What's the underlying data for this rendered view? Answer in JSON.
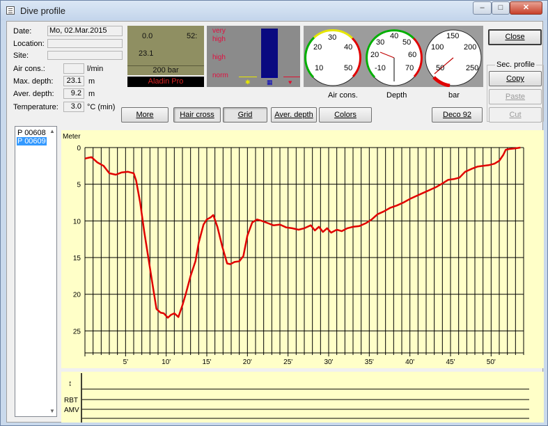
{
  "window": {
    "title": "Dive profile",
    "minimize": "–",
    "maximize": "□",
    "close": "✕"
  },
  "info": {
    "date_label": "Date:",
    "date_value": "Mo, 02.Mar.2015",
    "location_label": "Location:",
    "location_value": "",
    "site_label": "Site:",
    "site_value": "",
    "air_label": "Air cons.:",
    "air_value": "",
    "air_unit": "l/min",
    "maxdepth_label": "Max. depth:",
    "maxdepth_value": "23.1",
    "maxdepth_unit": "m",
    "averdepth_label": "Aver. depth:",
    "averdepth_value": "9.2",
    "averdepth_unit": "m",
    "temp_label": "Temperature:",
    "temp_value": "3.0",
    "temp_unit": "°C  (min)"
  },
  "computer": {
    "left": "0.0",
    "right": "52:",
    "depth": "23.1",
    "pressure": "200 bar",
    "brand": "Aladin Pro"
  },
  "levels": {
    "very_high_1": "very",
    "very_high_2": "high",
    "high": "high",
    "norm": "norm"
  },
  "gauges": {
    "air": {
      "caption": "Air cons.",
      "ticks": [
        "10",
        "20",
        "30",
        "40",
        "50"
      ]
    },
    "depth": {
      "caption": "Depth",
      "ticks": [
        "-10",
        "20",
        "30",
        "40",
        "50",
        "60",
        "70"
      ]
    },
    "bar": {
      "caption": "bar",
      "ticks": [
        "50",
        "100",
        "150",
        "200",
        "250"
      ]
    }
  },
  "toolbar": {
    "more": "More",
    "hair_cross": "Hair cross",
    "grid": "Grid",
    "aver_depth": "Aver. depth",
    "colors": "Colors",
    "deco": "Deco 92"
  },
  "side": {
    "close": "Close",
    "sec_profile": "Sec. profile",
    "copy": "Copy",
    "paste": "Paste",
    "cut": "Cut"
  },
  "profiles": [
    "P 00608",
    "P 00609"
  ],
  "chart_data": {
    "type": "line",
    "ylabel": "Meter",
    "xlabel": "",
    "y_reversed": true,
    "ylim": [
      0,
      28
    ],
    "xlim": [
      0,
      54
    ],
    "y_ticks": [
      0,
      5,
      10,
      15,
      20,
      25
    ],
    "x_tick_labels": [
      "5'",
      "10'",
      "15'",
      "20'",
      "25'",
      "30'",
      "35'",
      "40'",
      "45'",
      "50'"
    ],
    "x_ticks": [
      5,
      10,
      15,
      20,
      25,
      30,
      35,
      40,
      45,
      50
    ],
    "grid": true,
    "series": [
      {
        "color": "#e00000",
        "x": [
          0,
          0.8,
          1.5,
          2.3,
          3.0,
          3.8,
          4.5,
          5.3,
          6.0,
          6.3,
          6.8,
          7.3,
          7.8,
          8.3,
          8.8,
          9.3,
          9.7,
          10.2,
          10.6,
          11.0,
          11.5,
          12.0,
          12.4,
          13.0,
          13.6,
          14.0,
          14.6,
          15.0,
          15.5,
          15.8,
          16.3,
          16.9,
          17.5,
          17.9,
          18.4,
          19.0,
          19.5,
          20.0,
          20.6,
          21.2,
          21.8,
          22.5,
          23.2,
          24.0,
          24.8,
          25.5,
          26.3,
          27.0,
          27.8,
          28.3,
          28.8,
          29.3,
          29.8,
          30.3,
          31.0,
          31.6,
          32.3,
          33.0,
          33.8,
          34.6,
          35.3,
          36.0,
          36.8,
          37.6,
          38.4,
          39.2,
          40.0,
          40.8,
          41.6,
          42.4,
          43.2,
          44.0,
          44.7,
          45.4,
          46.1,
          46.8,
          47.6,
          48.3,
          49.0,
          49.7,
          50.4,
          51.0,
          51.5,
          51.8,
          52.2,
          53.0,
          53.6
        ],
        "y": [
          1.5,
          1.3,
          2.0,
          2.5,
          3.5,
          3.7,
          3.4,
          3.3,
          3.5,
          4.5,
          7.5,
          11.5,
          15.0,
          18.5,
          22.0,
          22.5,
          22.6,
          23.2,
          22.8,
          22.6,
          23.1,
          21.5,
          20.0,
          17.5,
          15.5,
          13.0,
          10.5,
          9.8,
          9.5,
          9.2,
          10.8,
          13.5,
          15.8,
          15.9,
          15.6,
          15.5,
          14.8,
          12.0,
          10.2,
          9.8,
          10.0,
          10.3,
          10.6,
          10.5,
          10.9,
          11.0,
          11.2,
          11.0,
          10.6,
          11.3,
          10.8,
          11.5,
          11.0,
          11.6,
          11.2,
          11.4,
          11.0,
          10.8,
          10.7,
          10.3,
          9.8,
          9.1,
          8.7,
          8.2,
          7.9,
          7.5,
          7.0,
          6.6,
          6.2,
          5.8,
          5.4,
          4.9,
          4.4,
          4.3,
          4.1,
          3.3,
          2.9,
          2.6,
          2.5,
          2.4,
          2.2,
          1.8,
          1.0,
          0.3,
          0.2,
          0.1,
          0.0
        ]
      }
    ]
  },
  "bottom_chart": {
    "symbol": "↕",
    "rbt": "RBT",
    "amv": "AMV"
  }
}
